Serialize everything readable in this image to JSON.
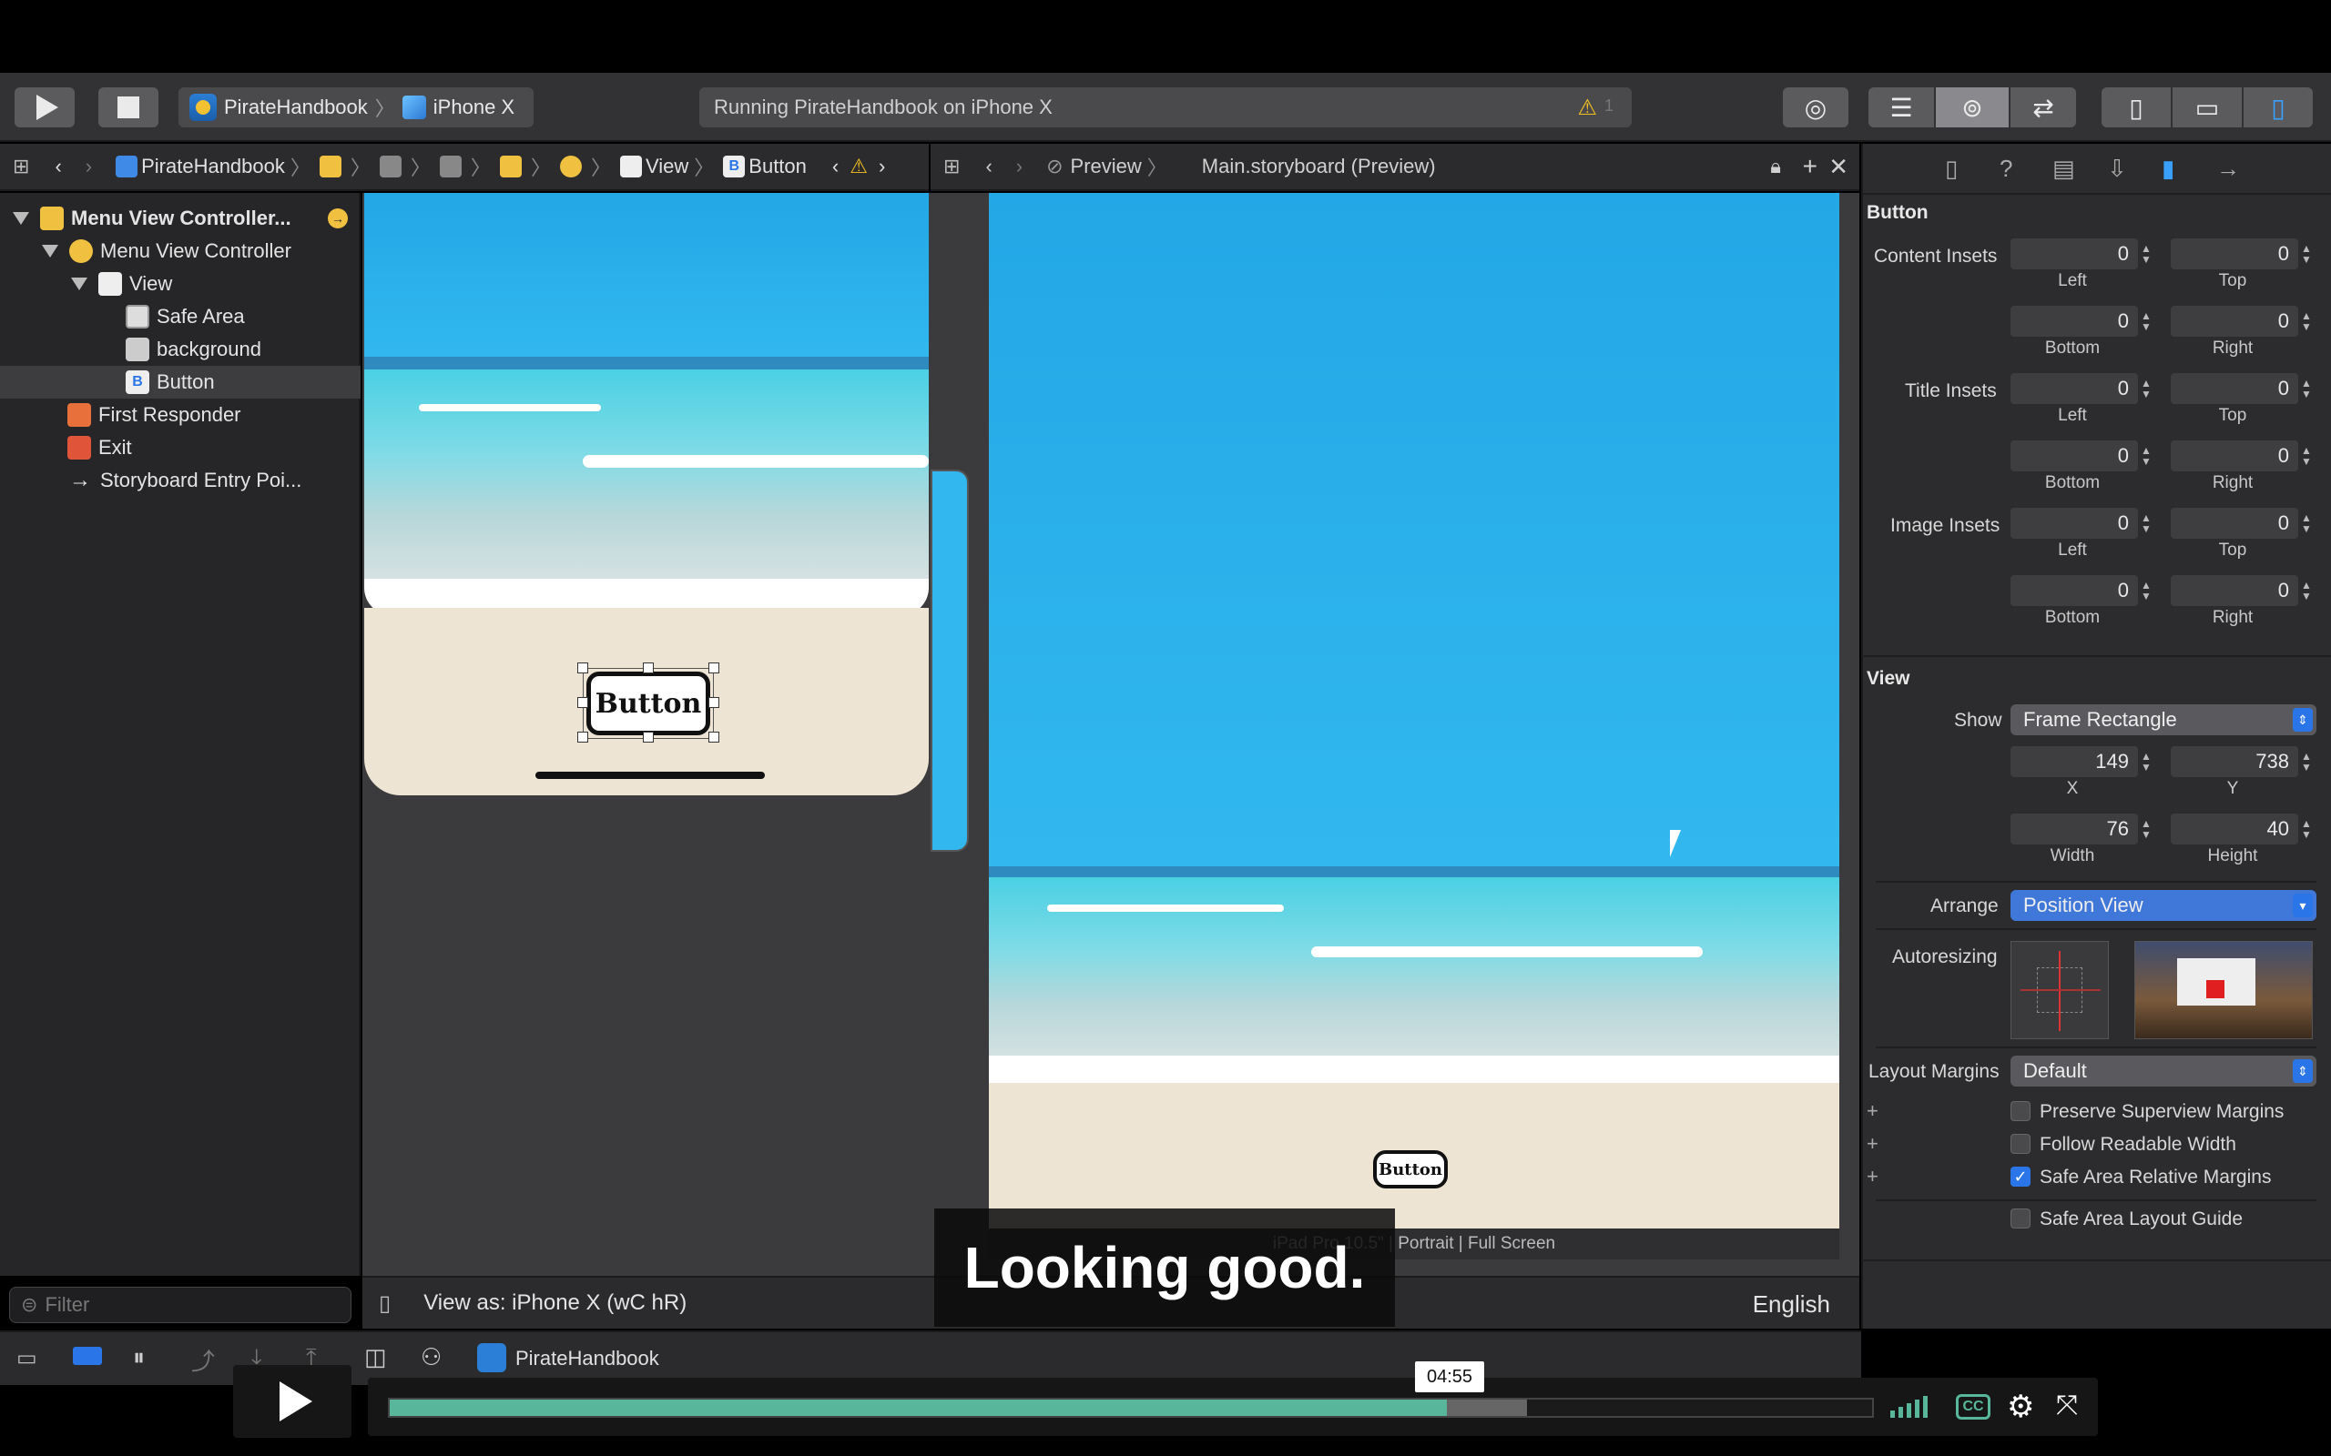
{
  "toolbar": {
    "scheme": {
      "app": "PirateHandbook",
      "device": "iPhone X"
    },
    "activity": {
      "status": "Running PirateHandbook on iPhone X",
      "warnings": "1"
    }
  },
  "jumpbar_left": {
    "items": [
      "PirateHandbook",
      "View",
      "Button"
    ]
  },
  "jumpbar_right": {
    "preview_label": "Preview",
    "file": "Main.storyboard (Preview)"
  },
  "outline": {
    "items": [
      {
        "label": "Menu View Controller..."
      },
      {
        "label": "Menu View Controller"
      },
      {
        "label": "View"
      },
      {
        "label": "Safe Area"
      },
      {
        "label": "background"
      },
      {
        "label": "Button"
      },
      {
        "label": "First Responder"
      },
      {
        "label": "Exit"
      },
      {
        "label": "Storyboard Entry Poi..."
      }
    ],
    "filter_placeholder": "Filter"
  },
  "canvas": {
    "button_label": "Button",
    "view_as": "View as: iPhone X (wC hR)",
    "preview_footer": "iPad Pro 10.5\" | Portrait | Full Screen",
    "language": "English"
  },
  "inspector": {
    "button_section": "Button",
    "content_insets": {
      "label": "Content Insets",
      "left": "0",
      "top": "0",
      "bottom": "0",
      "right": "0"
    },
    "title_insets": {
      "label": "Title Insets",
      "left": "0",
      "top": "0",
      "bottom": "0",
      "right": "0"
    },
    "image_insets": {
      "label": "Image Insets",
      "left": "0",
      "top": "0",
      "bottom": "0",
      "right": "0"
    },
    "sub": {
      "left": "Left",
      "top": "Top",
      "bottom": "Bottom",
      "right": "Right"
    },
    "view_section": "View",
    "show_label": "Show",
    "show_value": "Frame Rectangle",
    "frame": {
      "x": "149",
      "y": "738",
      "width": "76",
      "height": "40",
      "x_label": "X",
      "y_label": "Y",
      "width_label": "Width",
      "height_label": "Height"
    },
    "arrange_label": "Arrange",
    "arrange_value": "Position View",
    "autoresizing_label": "Autoresizing",
    "layout_margins_label": "Layout Margins",
    "layout_margins_value": "Default",
    "checks": [
      {
        "label": "Preserve Superview Margins",
        "checked": false
      },
      {
        "label": "Follow Readable Width",
        "checked": false
      },
      {
        "label": "Safe Area Relative Margins",
        "checked": true
      },
      {
        "label": "Safe Area Layout Guide",
        "checked": false
      }
    ]
  },
  "debugbar": {
    "target": "PirateHandbook"
  },
  "video": {
    "time": "04:55",
    "caption": "Looking good.",
    "progress_played": 0.713,
    "progress_loaded": 0.767
  }
}
